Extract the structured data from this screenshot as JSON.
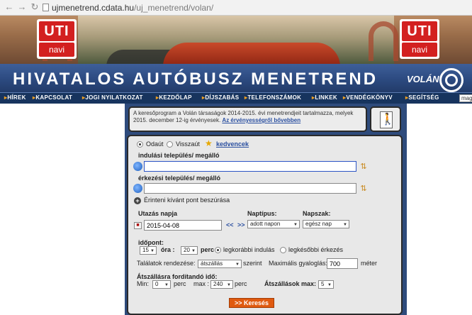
{
  "browser": {
    "url_host": "ujmenetrend.cdata.hu",
    "url_path": "/uj_menetrend/volan/"
  },
  "banner": {
    "uti_top": "UTI",
    "uti_bottom": "navi"
  },
  "header": {
    "title": "HIVATALOS AUTÓBUSZ MENETREND",
    "brand": "VOLÁN"
  },
  "menu": {
    "items": [
      "HÍREK",
      "KAPCSOLAT",
      "JOGI NYILATKOZAT",
      "KEZDŐLAP",
      "DÍJSZABÁS",
      "TELEFONSZÁMOK",
      "LINKEK",
      "VENDÉGKÖNYV",
      "SEGÍTSÉG"
    ],
    "search_value": "mag"
  },
  "info": {
    "text": "A keresőprogram a Volán társaságok 2014-2015. évi menetrendjeit tartalmazza, melyek 2015. december 12-ig érvényesek.",
    "link": "Az érvényességről bővebben"
  },
  "form": {
    "direction_there": "Odaút",
    "direction_back": "Visszaút",
    "favorites": "kedvencek",
    "departure_label": "indulási település/ megálló",
    "departure_value": "",
    "arrival_label": "érkezési település/ megálló",
    "arrival_value": "",
    "add_stop": "Érinteni kívánt pont beszúrása",
    "travel_day_label": "Utazás napja",
    "date_value": "2015-04-08",
    "date_prev": "<<",
    "date_next": ">>",
    "day_type_label": "Naptípus:",
    "day_type_value": "adott napon",
    "day_part_label": "Napszak:",
    "day_part_value": "egész nap",
    "time_label": "időpont:",
    "hour_value": "15",
    "hour_label": "óra :",
    "minute_value": "20",
    "minute_label": "perc",
    "earliest_departure": "legkorábbi indulás",
    "latest_arrival": "legkésőbbi érkezés",
    "sort_label": "Találatok rendezése:",
    "sort_value": "átszállás",
    "sort_suffix": "szerint",
    "max_walk_label": "Maximális gyaloglás:",
    "max_walk_value": "700",
    "max_walk_unit": "méter",
    "transfer_time_label": "Átszállásra fordítandó idő:",
    "min_label": "Min:",
    "min_value": "0",
    "min_unit": "perc",
    "max_label": "max :",
    "max_value": "240",
    "max_unit": "perc",
    "max_transfers_label": "Átszállások max:",
    "max_transfers_value": "5",
    "search_button": ">> Keresés"
  }
}
